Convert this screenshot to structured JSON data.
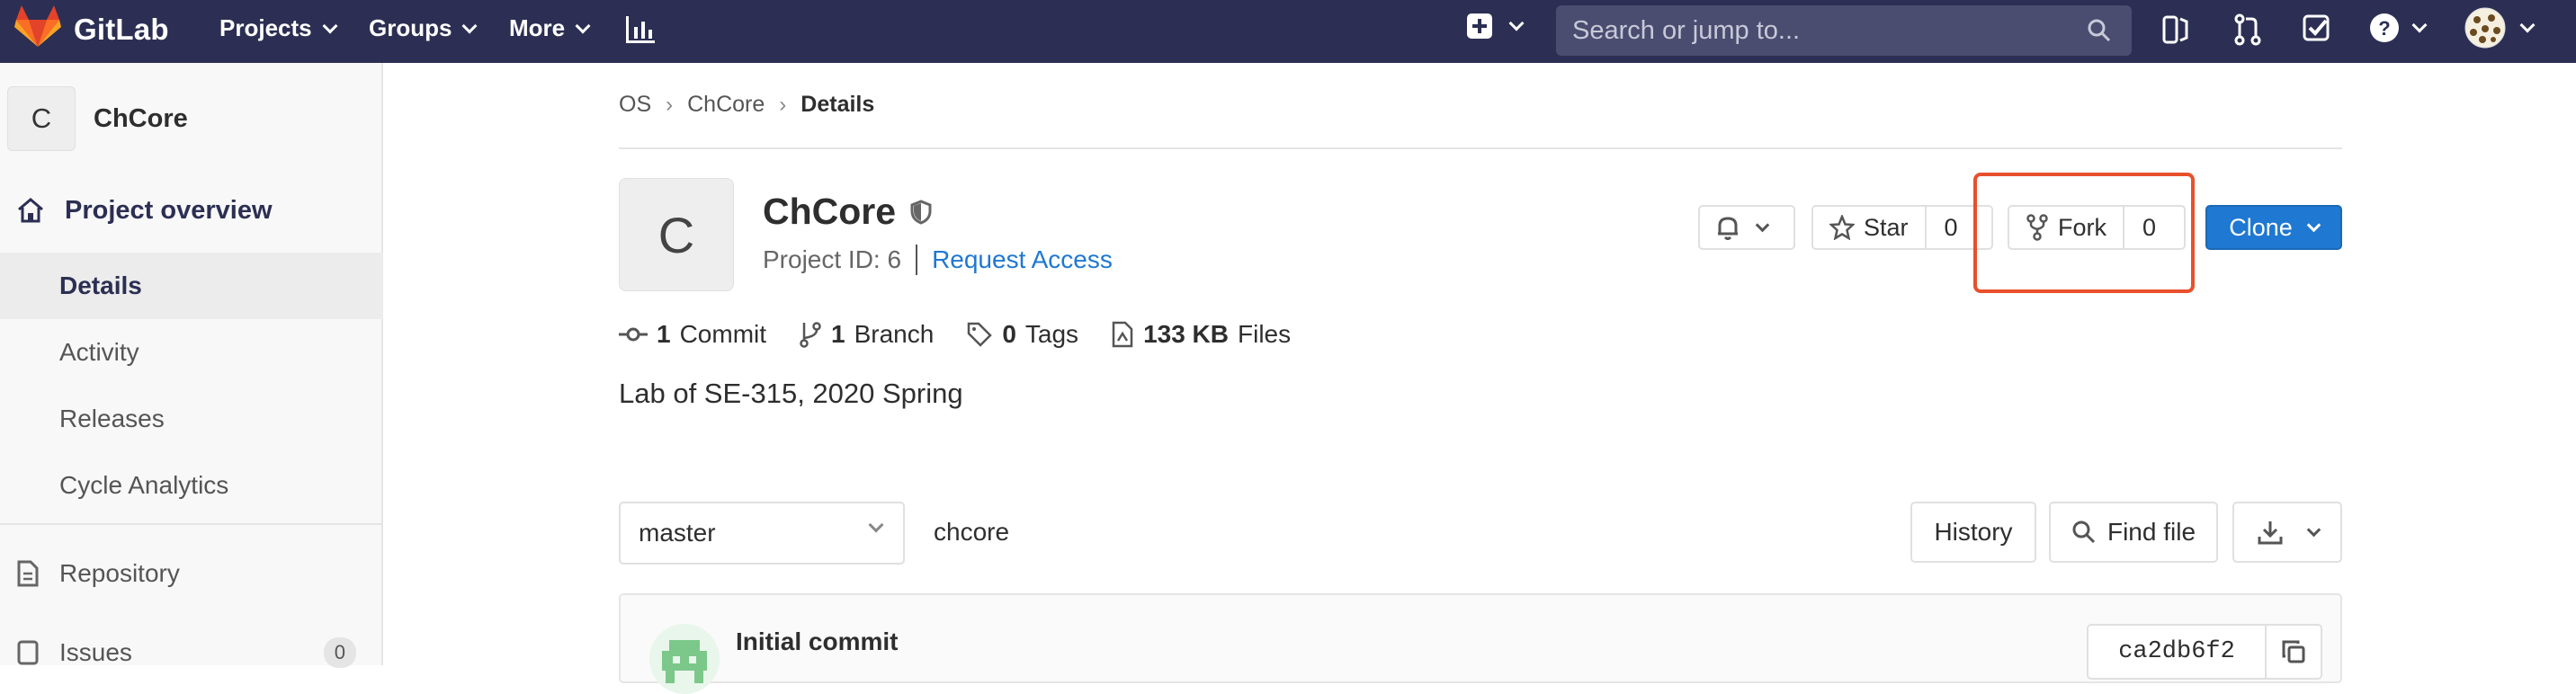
{
  "navbar": {
    "brand": "GitLab",
    "menu": [
      {
        "label": "Projects"
      },
      {
        "label": "Groups"
      },
      {
        "label": "More"
      }
    ],
    "search_placeholder": "Search or jump to..."
  },
  "sidebar": {
    "project_initial": "C",
    "project_name": "ChCore",
    "overview_label": "Project overview",
    "sub_items": [
      "Details",
      "Activity",
      "Releases",
      "Cycle Analytics"
    ],
    "repository_label": "Repository",
    "issues_label": "Issues",
    "issues_count": "0"
  },
  "breadcrumb": [
    "OS",
    "ChCore",
    "Details"
  ],
  "project": {
    "initial": "C",
    "name": "ChCore",
    "id_text": "Project ID: 6",
    "request_access": "Request Access"
  },
  "actions": {
    "star_label": "Star",
    "star_count": "0",
    "fork_label": "Fork",
    "fork_count": "0",
    "clone_label": "Clone"
  },
  "stats": {
    "commits_count": "1",
    "commits_label": "Commit",
    "branches_count": "1",
    "branches_label": "Branch",
    "tags_count": "0",
    "tags_label": "Tags",
    "files_size": "133 KB",
    "files_label": "Files"
  },
  "description": "Lab of SE-315, 2020 Spring",
  "repo": {
    "branch": "master",
    "path": "chcore",
    "history_label": "History",
    "find_file_label": "Find file"
  },
  "commit": {
    "title": "Initial commit",
    "sha": "ca2db6f2"
  },
  "colors": {
    "navbar": "#2c2f53",
    "accent_blue": "#1f78d1",
    "highlight_red": "#e8502c"
  }
}
